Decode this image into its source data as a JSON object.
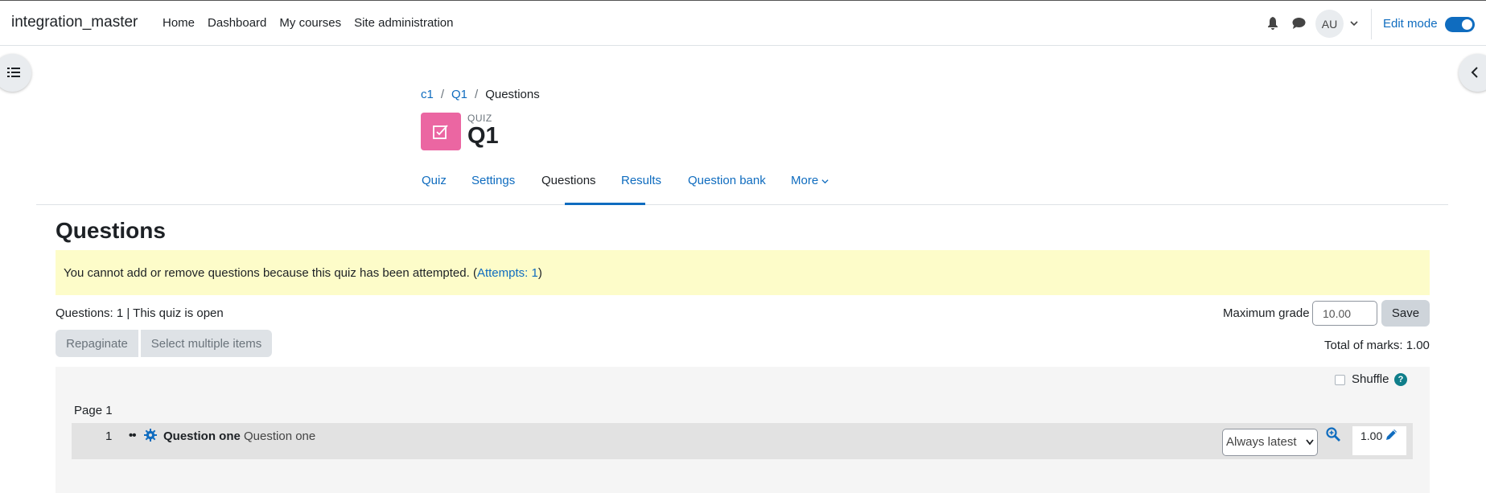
{
  "navbar": {
    "site_name": "integration_master",
    "links": [
      "Home",
      "Dashboard",
      "My courses",
      "Site administration"
    ],
    "user_initials": "AU",
    "edit_mode_label": "Edit mode",
    "edit_mode_on": true
  },
  "breadcrumb": [
    "c1",
    "Q1",
    "Questions"
  ],
  "activity": {
    "type": "QUIZ",
    "title": "Q1",
    "icon_color": "#eb66a2"
  },
  "tabs": [
    "Quiz",
    "Settings",
    "Questions",
    "Results",
    "Question bank",
    "More"
  ],
  "active_tab": "Questions",
  "page_heading": "Questions",
  "alert": {
    "text": "You cannot add or remove questions because this quiz has been attempted. (",
    "link": "Attempts: 1",
    "suffix": ")"
  },
  "status_line": "Questions: 1 | This quiz is open",
  "maximum_grade": {
    "label": "Maximum grade",
    "value": "10.00",
    "save_label": "Save"
  },
  "buttons": {
    "repaginate": "Repaginate",
    "select_multiple": "Select multiple items"
  },
  "total_marks": "Total of marks: 1.00",
  "shuffle_label": "Shuffle",
  "page_label": "Page 1",
  "question": {
    "number": "1",
    "name": "Question one",
    "text": "Question one",
    "version": "Always latest",
    "mark": "1.00"
  },
  "colors": {
    "link": "#0f6cbf",
    "alert_bg": "#fdfcc9",
    "help": "#0f7e8a"
  }
}
